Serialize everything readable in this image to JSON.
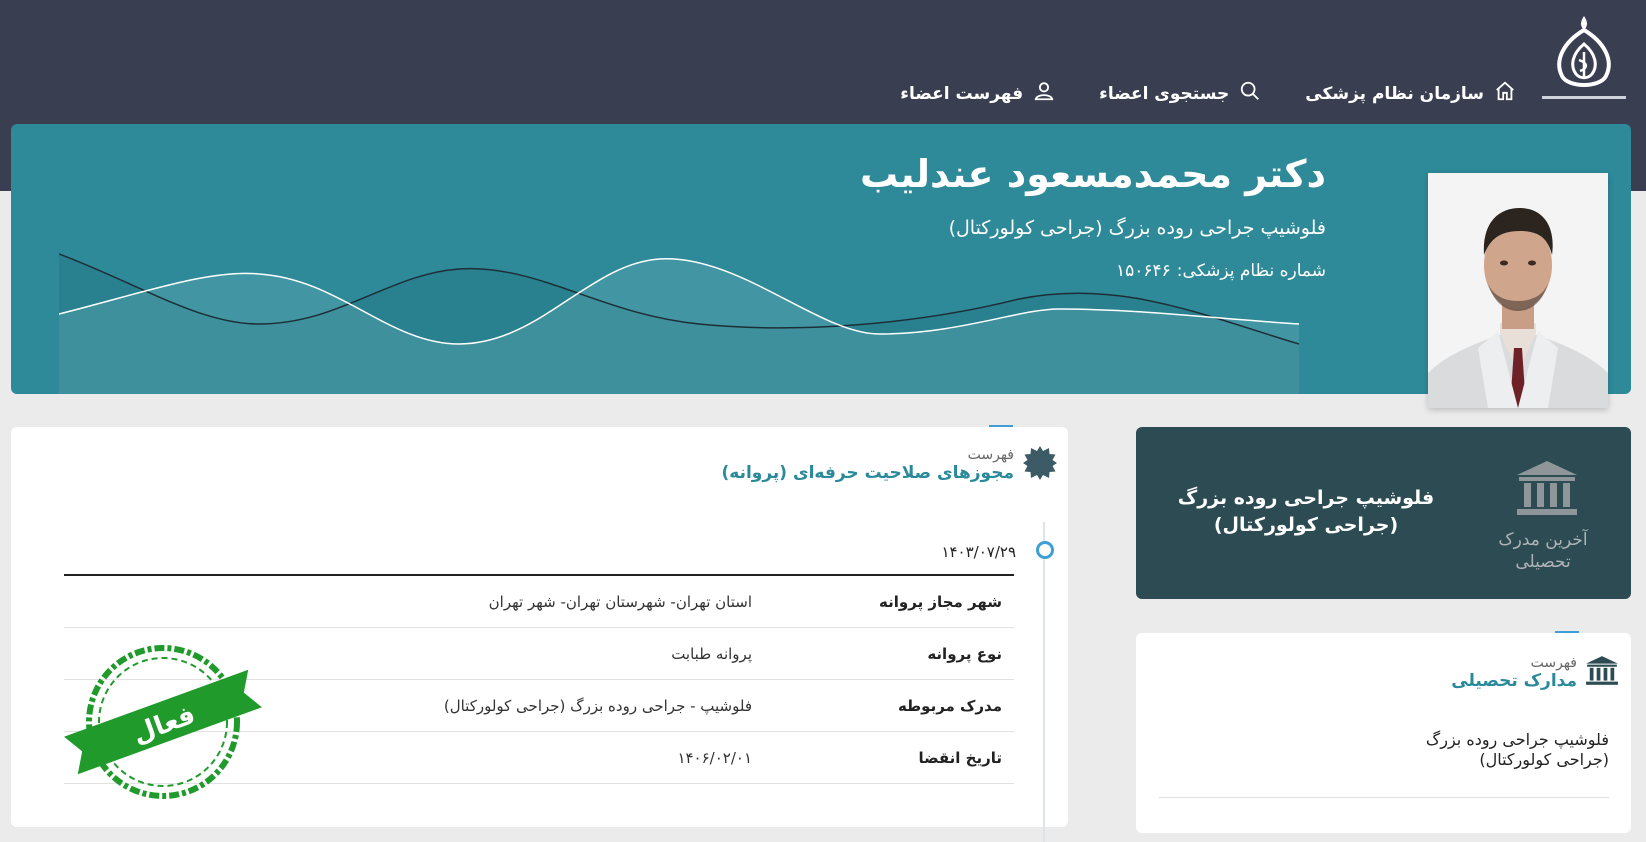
{
  "nav": {
    "home": "سازمان نظام پزشکی",
    "search": "جستجوی اعضاء",
    "members": "فهرست اعضاء"
  },
  "doctor": {
    "name": "دکتر محمدمسعود عندلیب",
    "specialty": "فلوشیپ جراحی روده بزرگ (جراحی کولورکتال)",
    "code_label": "شماره نظام پزشکی:",
    "code": "۱۵۰۶۴۶"
  },
  "licenses": {
    "small": "فهرست",
    "title": "مجوزهای صلاحیت حرفه‌ای (پروانه)",
    "date": "۱۴۰۳/۰۷/۲۹",
    "rows": [
      {
        "key": "شهر مجاز پروانه",
        "value": "استان تهران- شهرستان تهران- شهر تهران"
      },
      {
        "key": "نوع پروانه",
        "value": "پروانه طبابت"
      },
      {
        "key": "مدرک مربوطه",
        "value": "فلوشیپ - جراحی روده بزرگ (جراحی کولورکتال)"
      },
      {
        "key": "تاریخ انقضا",
        "value": "۱۴۰۶/۰۲/۰۱"
      }
    ],
    "stamp": "فعال"
  },
  "latest_degree": {
    "label": "آخرین مدرک تحصیلی",
    "title": "فلوشیپ جراحی روده بزرگ (جراحی کولورکتال)"
  },
  "education": {
    "small": "فهرست",
    "title": "مدارک تحصیلی",
    "item": "فلوشیپ جراحی روده بزرگ (جراحی کولورکتال)"
  },
  "colors": {
    "topbar": "#393e51",
    "hero": "#2e8a99",
    "accent": "#2b8a9a",
    "degree_card": "#2d4b52",
    "stamp": "#1f9a2b"
  }
}
